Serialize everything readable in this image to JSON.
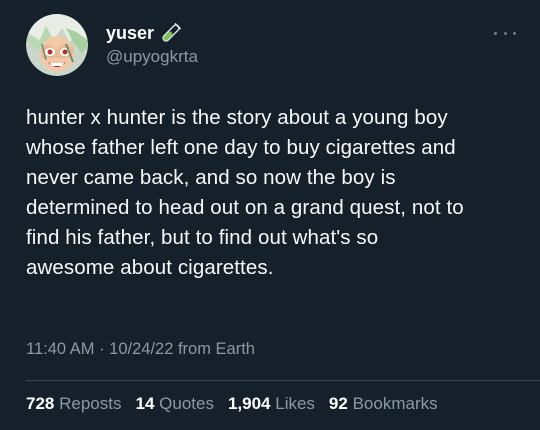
{
  "author": {
    "display_name": "yuser",
    "handle": "@upyogkrta",
    "name_icon": "test-tube-icon",
    "avatar": "avatar-icon"
  },
  "tweet": {
    "lines": [
      "hunter x hunter is the story about a young boy",
      "whose father left one day to buy cigarettes and",
      "never came back, and so now the boy is",
      "determined to head out on a grand quest, not to",
      "find his father, but to find out what's so",
      "awesome about cigarettes."
    ],
    "timestamp": "11:40 AM · 10/24/22 from Earth"
  },
  "stats": {
    "reposts_count": "728",
    "reposts_label": "Reposts",
    "quotes_count": "14",
    "quotes_label": "Quotes",
    "likes_count": "1,904",
    "likes_label": "Likes",
    "bookmarks_count": "92",
    "bookmarks_label": "Bookmarks"
  },
  "colors": {
    "background": "#15202b",
    "secondary_text": "#8b98a5",
    "accent_icon": "#7ac74f"
  }
}
